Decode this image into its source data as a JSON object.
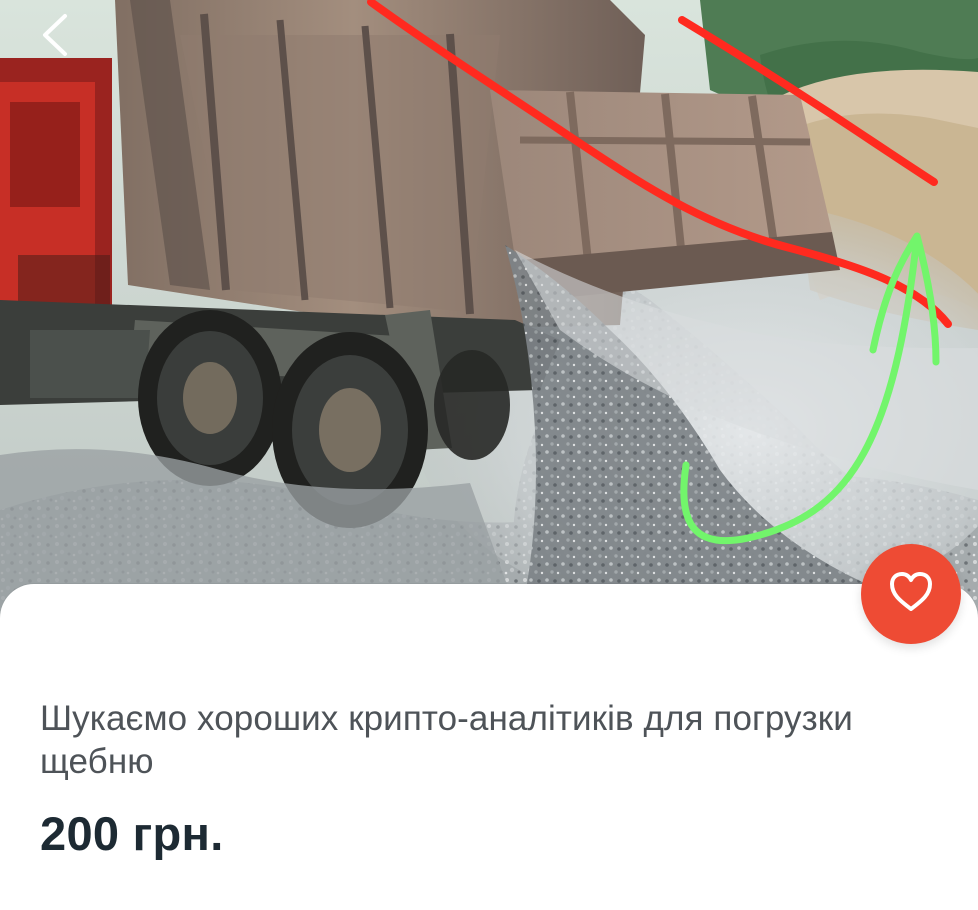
{
  "listing": {
    "title": "Шукаємо хороших крипто-аналітиків для погрузки щебню",
    "price": "200 грн."
  },
  "icons": {
    "back": "chevron-left-icon",
    "favorite": "heart-outline-icon"
  },
  "colors": {
    "favorite_button": "#ee4b34",
    "red_annotation": "#ff2a1f",
    "green_annotation": "#72f56b",
    "title_text": "#4e5358",
    "price_text": "#1d2a33"
  }
}
